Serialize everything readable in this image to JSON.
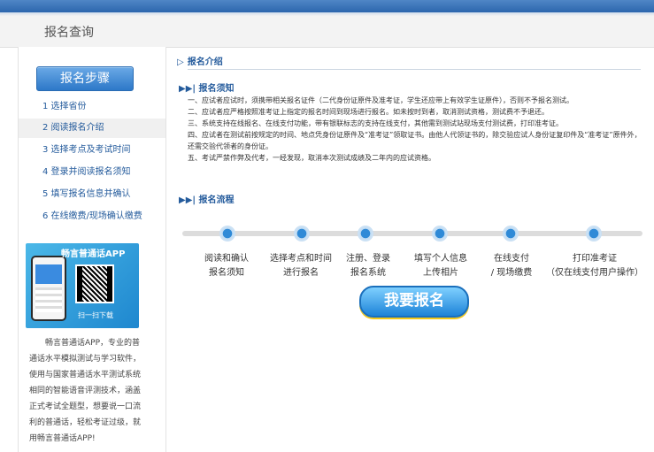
{
  "header": {
    "title": "报名查询"
  },
  "sidebar": {
    "steps_button": "报名步骤",
    "items": [
      {
        "label": "1 选择省份"
      },
      {
        "label": "2 阅读报名介绍"
      },
      {
        "label": "3 选择考点及考试时间"
      },
      {
        "label": "4 登录并阅读报名须知"
      },
      {
        "label": "5 填写报名信息并确认"
      },
      {
        "label": "6 在线缴费/现场确认缴费"
      }
    ],
    "app_banner": {
      "title": "畅言普通话APP",
      "scan": "扫一扫下载"
    },
    "app_desc": "畅言普通话APP，专业的普通话水平模拟测试与学习软件，使用与国家普通话水平测试系统相同的智能语音评测技术，涵盖正式考试全题型，想要说一口流利的普通话，轻松考证过级，就用畅言普通话APP!"
  },
  "main": {
    "intro_title": "报名介绍",
    "notice_title": "报名须知",
    "notice_lines": [
      "一、应试者应试时，须携带相关报名证件（二代身份证原件及准考证，学生还应带上有效学生证原件），否则不予报名测试。",
      "二、应试者应严格按照准考证上指定的报名时间到现场进行报名。如未按时到者，取消测试资格，测试费不予退还。",
      "三、系统支持在线报名、在线支付功能，带有银联标志的支持在线支付，其他需到测试站现场支付测试费，打印准考证。",
      "四、应试者在测试前按规定的时间、地点凭身份证原件及“准考证”领取证书。由他人代领证书的，除交验应试人身份证复印件及“准考证”原件外，还需交验代领者的身份证。",
      "五、考试严禁作弊及代考，一经发现，取消本次测试成绩及二年内的应试资格。"
    ],
    "flow_title": "报名流程",
    "flow_steps": [
      {
        "line1": "阅读和确认",
        "line2": "报名须知"
      },
      {
        "line1": "选择考点和时间",
        "line2": "进行报名"
      },
      {
        "line1": "注册、登录",
        "line2": "报名系统"
      },
      {
        "line1": "填写个人信息",
        "line2": "上传相片"
      },
      {
        "line1": "在线支付",
        "line2": "/ 现场缴费"
      },
      {
        "line1": "打印准考证",
        "line2": "（仅在线支付用户操作）"
      }
    ],
    "signup_button": "我要报名"
  },
  "colors": {
    "accent": "#245b9c",
    "topbar": "#2c66ad",
    "button": "#1d83d8"
  }
}
